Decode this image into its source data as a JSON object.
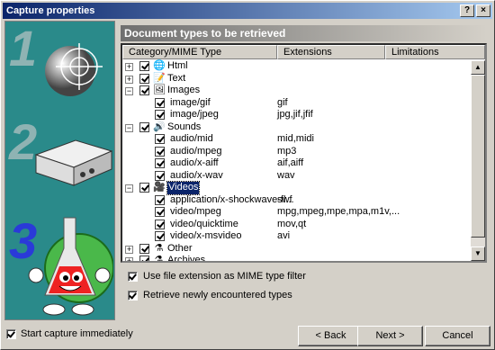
{
  "window": {
    "title": "Capture properties",
    "help_btn": "?",
    "close_btn": "×"
  },
  "sidebar": {
    "steps": [
      "1",
      "2",
      "3"
    ]
  },
  "panel": {
    "title": "Document types to be retrieved"
  },
  "columns": [
    "Category/MIME Type",
    "Extensions",
    "Limitations"
  ],
  "tree": [
    {
      "level": 0,
      "expand": "+",
      "checked": true,
      "icon": "html-icon",
      "glyph": "🌐",
      "label": "Html",
      "ext": ""
    },
    {
      "level": 0,
      "expand": "+",
      "checked": true,
      "icon": "text-icon",
      "glyph": "📝",
      "label": "Text",
      "ext": ""
    },
    {
      "level": 0,
      "expand": "−",
      "checked": true,
      "icon": "images-icon",
      "glyph": "🖼",
      "label": "Images",
      "ext": ""
    },
    {
      "level": 1,
      "checked": true,
      "label": "image/gif",
      "ext": "gif"
    },
    {
      "level": 1,
      "checked": true,
      "label": "image/jpeg",
      "ext": "jpg,jif,jfif"
    },
    {
      "level": 0,
      "expand": "−",
      "checked": true,
      "icon": "sounds-icon",
      "glyph": "🔊",
      "label": "Sounds",
      "ext": ""
    },
    {
      "level": 1,
      "checked": true,
      "label": "audio/mid",
      "ext": "mid,midi"
    },
    {
      "level": 1,
      "checked": true,
      "label": "audio/mpeg",
      "ext": "mp3"
    },
    {
      "level": 1,
      "checked": true,
      "label": "audio/x-aiff",
      "ext": "aif,aiff"
    },
    {
      "level": 1,
      "checked": true,
      "label": "audio/x-wav",
      "ext": "wav"
    },
    {
      "level": 0,
      "expand": "−",
      "checked": true,
      "icon": "videos-icon",
      "glyph": "🎥",
      "label": "Videos",
      "ext": "",
      "selected": true
    },
    {
      "level": 1,
      "checked": true,
      "label": "application/x-shockwave-fl...",
      "ext": "swf"
    },
    {
      "level": 1,
      "checked": true,
      "label": "video/mpeg",
      "ext": "mpg,mpeg,mpe,mpa,m1v,..."
    },
    {
      "level": 1,
      "checked": true,
      "label": "video/quicktime",
      "ext": "mov,qt"
    },
    {
      "level": 1,
      "checked": true,
      "label": "video/x-msvideo",
      "ext": "avi"
    },
    {
      "level": 0,
      "expand": "+",
      "checked": true,
      "icon": "other-icon",
      "glyph": "⚗",
      "label": "Other",
      "ext": ""
    },
    {
      "level": 0,
      "expand": "+",
      "checked": true,
      "icon": "archives-icon",
      "glyph": "⚗",
      "label": "Archives",
      "ext": ""
    }
  ],
  "options": {
    "use_ext": "Use file extension as MIME type filter",
    "retrieve_new": "Retrieve newly encountered types"
  },
  "start_capture": "Start capture immediately",
  "buttons": {
    "back": "< Back",
    "next": "Next >",
    "cancel": "Cancel"
  },
  "colors": {
    "accent": "#0a246a",
    "sidebar": "#2a8a8a"
  }
}
